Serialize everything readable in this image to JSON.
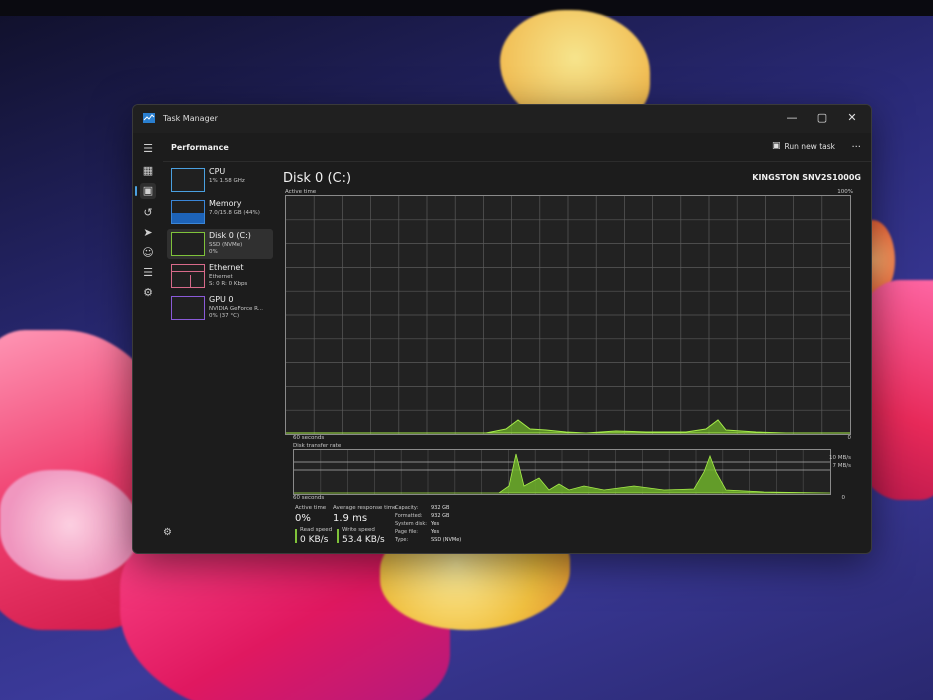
{
  "window": {
    "title": "Task Manager"
  },
  "header": {
    "section": "Performance",
    "run_new_task": "Run new task",
    "more": "..."
  },
  "rail": {
    "icons": [
      "hamburger-icon",
      "processes-icon",
      "performance-icon",
      "app-history-icon",
      "startup-apps-icon",
      "users-icon",
      "details-icon",
      "services-icon"
    ],
    "active": "performance-icon"
  },
  "devices": [
    {
      "name": "CPU",
      "sub1": "1% 1.58 GHz",
      "sub2": "",
      "accent": "#4aa0e0"
    },
    {
      "name": "Memory",
      "sub1": "7.0/15.8 GB (44%)",
      "sub2": "",
      "accent": "#3a86d8",
      "fill": 0.44
    },
    {
      "name": "Disk 0 (C:)",
      "sub1": "SSD (NVMe)",
      "sub2": "0%",
      "accent": "#7fc23a"
    },
    {
      "name": "Ethernet",
      "sub1": "Ethernet",
      "sub2": "S: 0 R: 0 Kbps",
      "accent": "#d86a8a"
    },
    {
      "name": "GPU 0",
      "sub1": "NVIDIA GeForce R...",
      "sub2": "0% (37 °C)",
      "accent": "#8a5ad8"
    }
  ],
  "disk": {
    "title": "Disk 0 (C:)",
    "model": "KINGSTON SNV2S1000G",
    "active_time_label": "Active time",
    "active_time_max": "100%",
    "sixty_seconds": "60 seconds",
    "zero": "0",
    "transfer_rate_label": "Disk transfer rate",
    "transfer_max": "10 MB/s",
    "transfer_mid": "7 MB/s",
    "sixty_seconds_2": "60 seconds",
    "zero_2": "0",
    "accent": "#8fd83a"
  },
  "stats": {
    "active_time_label": "Active time",
    "active_time_value": "0%",
    "avg_response_label": "Average response time",
    "avg_response_value": "1.9 ms",
    "read_speed_label": "Read speed",
    "read_speed_value": "0 KB/s",
    "write_speed_label": "Write speed",
    "write_speed_value": "53.4 KB/s",
    "properties": [
      {
        "label": "Capacity:",
        "value": "932 GB"
      },
      {
        "label": "Formatted:",
        "value": "932 GB"
      },
      {
        "label": "System disk:",
        "value": "Yes"
      },
      {
        "label": "Page file:",
        "value": "Yes"
      },
      {
        "label": "Type:",
        "value": "SSD (NVMe)"
      }
    ]
  }
}
